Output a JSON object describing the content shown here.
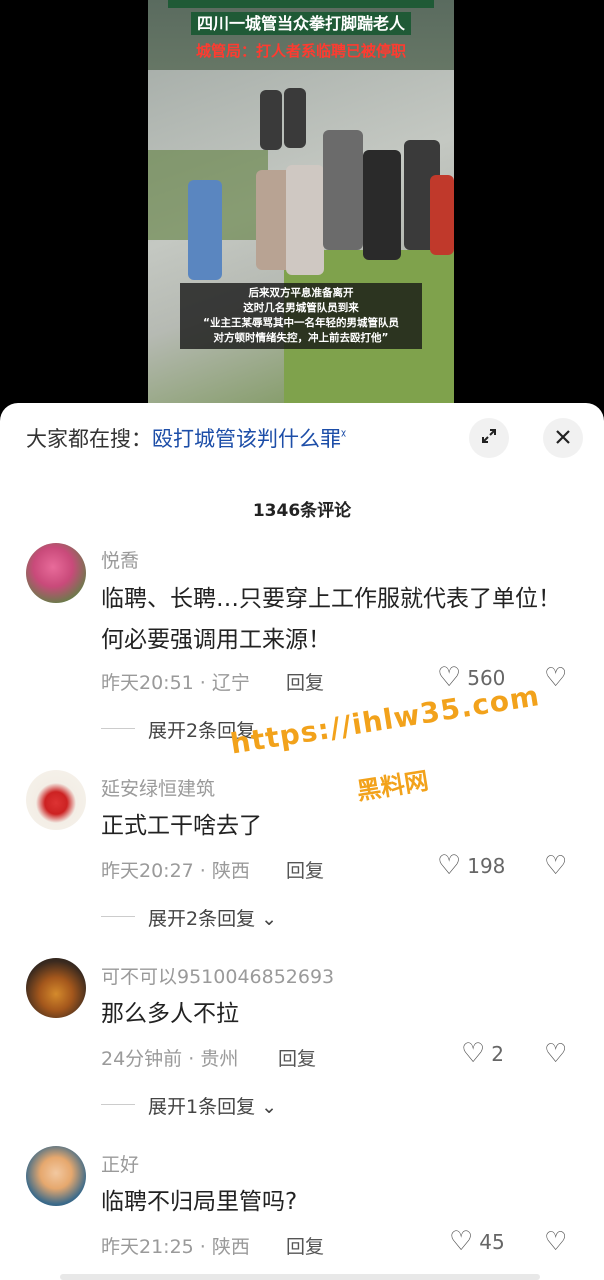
{
  "video": {
    "headline_main": "四川一城管当众拳打脚踹老人",
    "headline_sub": "城管局：打人者系临聘已被停职",
    "subtitle_lines": [
      "后来双方平息准备离开",
      "这时几名男城管队员到来",
      "“业主王某辱骂其中一名年轻的男城管队员",
      "对方顿时情绪失控，冲上前去殴打他”"
    ]
  },
  "search": {
    "prefix": "大家都在搜：",
    "query": "殴打城管该判什么罪",
    "query_icon": "search-icon"
  },
  "comments_header": {
    "count_label": "1346条评论"
  },
  "comments": [
    {
      "username": "悦喬",
      "text": "临聘、长聘…只要穿上工作服就代表了单位！何必要强调用工来源！",
      "time": "昨天20:51",
      "location": "辽宁",
      "reply_label": "回复",
      "likes": "560",
      "expand_label": "展开2条回复"
    },
    {
      "username": "延安绿恒建筑",
      "text": "正式工干啥去了",
      "time": "昨天20:27",
      "location": "陕西",
      "reply_label": "回复",
      "likes": "198",
      "expand_label": "展开2条回复"
    },
    {
      "username": "可不可以9510046852693",
      "text": "那么多人不拉",
      "time": "24分钟前",
      "location": "贵州",
      "reply_label": "回复",
      "likes": "2",
      "expand_label": "展开1条回复"
    },
    {
      "username": "正好",
      "text": "临聘不归局里管吗?",
      "time": "昨天21:25",
      "location": "陕西",
      "reply_label": "回复",
      "likes": "45",
      "expand_label": ""
    }
  ],
  "watermark": {
    "url": "https://ihlw35.com",
    "name": "黑料网"
  },
  "colors": {
    "accent_link": "#1d4ea8",
    "watermark": "#f2a21b",
    "headline_red": "#ff3b30",
    "headline_bg": "#1f5a36"
  }
}
